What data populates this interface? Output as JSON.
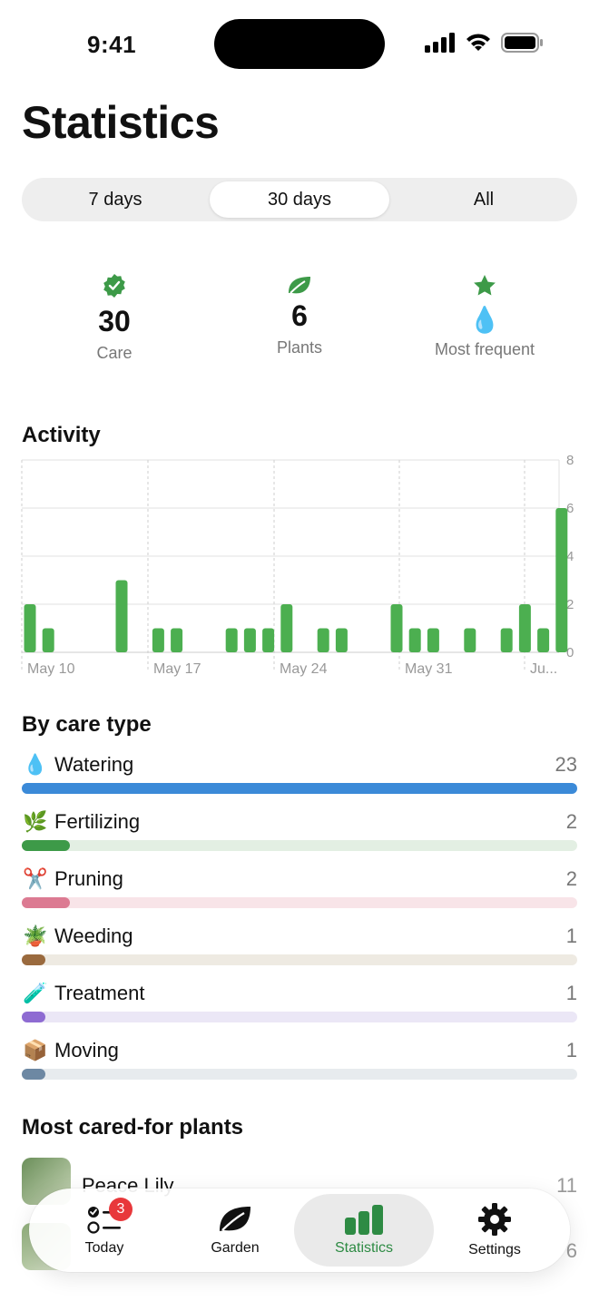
{
  "status_bar": {
    "time": "9:41"
  },
  "page_title": "Statistics",
  "range_tabs": [
    {
      "label": "7 days",
      "active": false
    },
    {
      "label": "30 days",
      "active": true
    },
    {
      "label": "All",
      "active": false
    }
  ],
  "summary": [
    {
      "icon": "verified-badge-icon",
      "value": "30",
      "label": "Care"
    },
    {
      "icon": "leaf-icon",
      "value": "6",
      "label": "Plants"
    },
    {
      "icon": "star-icon",
      "value": "💧",
      "label": "Most frequent"
    }
  ],
  "activity": {
    "title": "Activity",
    "chart_data": {
      "type": "bar",
      "x_tick_labels": [
        "May 10",
        "May 17",
        "May 24",
        "May 31",
        "Ju..."
      ],
      "y_ticks": [
        0,
        2,
        4,
        6,
        8
      ],
      "ylim": [
        0,
        8
      ],
      "values": [
        2,
        1,
        0,
        0,
        0,
        3,
        0,
        1,
        1,
        0,
        0,
        1,
        1,
        1,
        2,
        0,
        1,
        1,
        0,
        0,
        2,
        1,
        1,
        0,
        1,
        0,
        1,
        2,
        1,
        6
      ],
      "color": "#4caf50",
      "grid": true
    }
  },
  "care_types": {
    "title": "By care type",
    "items": [
      {
        "emoji": "💧",
        "label": "Watering",
        "count": "23",
        "fraction": 1.0,
        "color": "#3b8ad8",
        "track": "#dbe9f7"
      },
      {
        "emoji": "🌿",
        "label": "Fertilizing",
        "count": "2",
        "fraction": 0.087,
        "color": "#3d9a48",
        "track": "#e3efe3"
      },
      {
        "emoji": "✂️",
        "label": "Pruning",
        "count": "2",
        "fraction": 0.087,
        "color": "#dc7a92",
        "track": "#f8e4e8"
      },
      {
        "emoji": "🪴",
        "label": "Weeding",
        "count": "1",
        "fraction": 0.043,
        "color": "#9a6a3e",
        "track": "#eeeae2"
      },
      {
        "emoji": "🧪",
        "label": "Treatment",
        "count": "1",
        "fraction": 0.043,
        "color": "#8e6bd2",
        "track": "#ebe7f6"
      },
      {
        "emoji": "📦",
        "label": "Moving",
        "count": "1",
        "fraction": 0.043,
        "color": "#6d88a3",
        "track": "#e7ebee"
      }
    ]
  },
  "plants": {
    "title": "Most cared-for plants",
    "items": [
      {
        "name": "Peace Lily",
        "count": "11"
      },
      {
        "name": "",
        "count": "6"
      }
    ]
  },
  "tabbar": {
    "today_label": "Today",
    "today_badge": "3",
    "garden_label": "Garden",
    "statistics_label": "Statistics",
    "settings_label": "Settings"
  }
}
